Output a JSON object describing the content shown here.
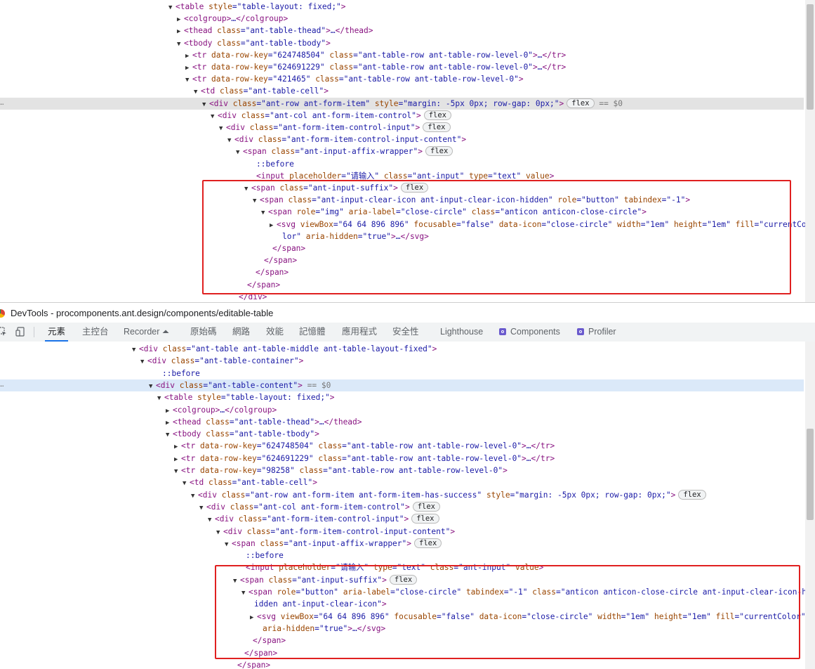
{
  "top_panel": {
    "lines": [
      {
        "indent": 250,
        "arrow": "open",
        "html": "<span class='t-tag'>&lt;table</span> <span class='t-attr'>style</span>=<span class='t-val'>\"table-layout: fixed;\"</span><span class='t-tag'>&gt;</span>"
      },
      {
        "indent": 262,
        "arrow": "closed",
        "html": "<span class='t-tag'>&lt;colgroup&gt;</span>…<span class='t-tag'>&lt;/colgroup&gt;</span>"
      },
      {
        "indent": 262,
        "arrow": "closed",
        "html": "<span class='t-tag'>&lt;thead</span> <span class='t-attr'>class</span>=<span class='t-val'>\"ant-table-thead\"</span><span class='t-tag'>&gt;</span>…<span class='t-tag'>&lt;/thead&gt;</span>"
      },
      {
        "indent": 262,
        "arrow": "open",
        "html": "<span class='t-tag'>&lt;tbody</span> <span class='t-attr'>class</span>=<span class='t-val'>\"ant-table-tbody\"</span><span class='t-tag'>&gt;</span>"
      },
      {
        "indent": 274,
        "arrow": "closed",
        "html": "<span class='t-tag'>&lt;tr</span> <span class='t-attr'>data-row-key</span>=<span class='t-val'>\"624748504\"</span> <span class='t-attr'>class</span>=<span class='t-val'>\"ant-table-row ant-table-row-level-0\"</span><span class='t-tag'>&gt;</span>…<span class='t-tag'>&lt;/tr&gt;</span>"
      },
      {
        "indent": 274,
        "arrow": "closed",
        "html": "<span class='t-tag'>&lt;tr</span> <span class='t-attr'>data-row-key</span>=<span class='t-val'>\"624691229\"</span> <span class='t-attr'>class</span>=<span class='t-val'>\"ant-table-row ant-table-row-level-0\"</span><span class='t-tag'>&gt;</span>…<span class='t-tag'>&lt;/tr&gt;</span>"
      },
      {
        "indent": 274,
        "arrow": "open",
        "html": "<span class='t-tag'>&lt;tr</span> <span class='t-attr'>data-row-key</span>=<span class='t-val'>\"421465\"</span> <span class='t-attr'>class</span>=<span class='t-val'>\"ant-table-row ant-table-row-level-0\"</span><span class='t-tag'>&gt;</span>"
      },
      {
        "indent": 286,
        "arrow": "open",
        "html": "<span class='t-tag'>&lt;td</span> <span class='t-attr'>class</span>=<span class='t-val'>\"ant-table-cell\"</span><span class='t-tag'>&gt;</span>"
      },
      {
        "indent": 298,
        "arrow": "open",
        "selected": "gray",
        "html": "<span class='t-tag'>&lt;div</span> <span class='t-attr'>class</span>=<span class='t-val'>\"ant-row ant-form-item\"</span> <span class='t-attr'>style</span>=<span class='t-val'>\"margin: -5px 0px; row-gap: 0px;\"</span><span class='t-tag'>&gt;</span><span class='badge'>flex</span> <span class='t-dim'>== $0</span>"
      },
      {
        "indent": 310,
        "arrow": "open",
        "html": "<span class='t-tag'>&lt;div</span> <span class='t-attr'>class</span>=<span class='t-val'>\"ant-col ant-form-item-control\"</span><span class='t-tag'>&gt;</span><span class='badge'>flex</span>"
      },
      {
        "indent": 322,
        "arrow": "open",
        "html": "<span class='t-tag'>&lt;div</span> <span class='t-attr'>class</span>=<span class='t-val'>\"ant-form-item-control-input\"</span><span class='t-tag'>&gt;</span><span class='badge'>flex</span>"
      },
      {
        "indent": 334,
        "arrow": "open",
        "html": "<span class='t-tag'>&lt;div</span> <span class='t-attr'>class</span>=<span class='t-val'>\"ant-form-item-control-input-content\"</span><span class='t-tag'>&gt;</span>"
      },
      {
        "indent": 346,
        "arrow": "open",
        "html": "<span class='t-tag'>&lt;span</span> <span class='t-attr'>class</span>=<span class='t-val'>\"ant-input-affix-wrapper\"</span><span class='t-tag'>&gt;</span><span class='badge'>flex</span>"
      },
      {
        "indent": 365,
        "arrow": "none",
        "html": "<span class='t-pseudo'>::before</span>"
      },
      {
        "indent": 365,
        "arrow": "none",
        "html": "<span class='t-tag'>&lt;input</span> <span class='t-attr'>placeholder</span>=<span class='t-val'>\"请输入\"</span> <span class='t-attr'>class</span>=<span class='t-val'>\"ant-input\"</span> <span class='t-attr'>type</span>=<span class='t-val'>\"text\"</span> <span class='t-attr'>value</span><span class='t-tag'>&gt;</span>"
      },
      {
        "indent": 358,
        "arrow": "open",
        "html": "<span class='t-tag'>&lt;span</span> <span class='t-attr'>class</span>=<span class='t-val'>\"ant-input-suffix\"</span><span class='t-tag'>&gt;</span><span class='badge'>flex</span>"
      },
      {
        "indent": 370,
        "arrow": "open",
        "html": "<span class='t-tag'>&lt;span</span> <span class='t-attr'>class</span>=<span class='t-val'>\"ant-input-clear-icon ant-input-clear-icon-hidden\"</span> <span class='t-attr'>role</span>=<span class='t-val'>\"button\"</span> <span class='t-attr'>tabindex</span>=<span class='t-val'>\"-1\"</span><span class='t-tag'>&gt;</span>"
      },
      {
        "indent": 382,
        "arrow": "open",
        "html": "<span class='t-tag'>&lt;span</span> <span class='t-attr'>role</span>=<span class='t-val'>\"img\"</span> <span class='t-attr'>aria-label</span>=<span class='t-val'>\"close-circle\"</span> <span class='t-attr'>class</span>=<span class='t-val'>\"anticon anticon-close-circle\"</span><span class='t-tag'>&gt;</span>"
      },
      {
        "indent": 394,
        "arrow": "closed",
        "html": "<span class='t-tag'>&lt;svg</span> <span class='t-attr'>viewBox</span>=<span class='t-val'>\"64 64 896 896\"</span> <span class='t-attr'>focusable</span>=<span class='t-val'>\"false\"</span> <span class='t-attr'>data-icon</span>=<span class='t-val'>\"close-circle\"</span> <span class='t-attr'>width</span>=<span class='t-val'>\"1em\"</span> <span class='t-attr'>height</span>=<span class='t-val'>\"1em\"</span> <span class='t-attr'>fill</span>=<span class='t-val'>\"currentCo</span>"
      },
      {
        "indent": 402,
        "arrow": "none",
        "html": "<span class='t-val'>lor\"</span> <span class='t-attr'>aria-hidden</span>=<span class='t-val'>\"true\"</span><span class='t-tag'>&gt;</span>…<span class='t-tag'>&lt;/svg&gt;</span>"
      },
      {
        "indent": 388,
        "arrow": "none",
        "html": "<span class='t-tag'>&lt;/span&gt;</span>"
      },
      {
        "indent": 376,
        "arrow": "none",
        "html": "<span class='t-tag'>&lt;/span&gt;</span>"
      },
      {
        "indent": 364,
        "arrow": "none",
        "html": "<span class='t-tag'>&lt;/span&gt;</span>"
      },
      {
        "indent": 352,
        "arrow": "none",
        "html": "<span class='t-tag'>&lt;/span&gt;</span>"
      },
      {
        "indent": 340,
        "arrow": "none",
        "html": "<span class='t-tag'>&lt;/div&gt;</span>"
      }
    ]
  },
  "titlebar": {
    "title": "DevTools - procomponents.ant.design/components/editable-table"
  },
  "tabs": [
    {
      "label": "元素",
      "active": true
    },
    {
      "label": "主控台"
    },
    {
      "label": "Recorder ⏶"
    },
    {
      "label": "原始碼"
    },
    {
      "label": "網路"
    },
    {
      "label": "效能"
    },
    {
      "label": "記憶體"
    },
    {
      "label": "應用程式"
    },
    {
      "label": "安全性"
    },
    {
      "label": "Lighthouse"
    },
    {
      "label": "Components",
      "icon": "react-extension-icon"
    },
    {
      "label": "Profiler",
      "icon": "react-extension-icon"
    }
  ],
  "bottom_panel": {
    "lines": [
      {
        "indent": 198,
        "arrow": "open",
        "html": "<span class='t-tag'>&lt;div</span> <span class='t-attr'>class</span>=<span class='t-val'>\"ant-table ant-table-middle ant-table-layout-fixed\"</span><span class='t-tag'>&gt;</span>"
      },
      {
        "indent": 210,
        "arrow": "open",
        "html": "<span class='t-tag'>&lt;div</span> <span class='t-attr'>class</span>=<span class='t-val'>\"ant-table-container\"</span><span class='t-tag'>&gt;</span>"
      },
      {
        "indent": 231,
        "arrow": "none",
        "html": "<span class='t-pseudo'>::before</span>"
      },
      {
        "indent": 222,
        "arrow": "open",
        "selected": "blue",
        "html": "<span class='t-tag'>&lt;div</span> <span class='t-attr'>class</span>=<span class='t-val'>\"ant-table-content\"</span><span class='t-tag'>&gt;</span> <span class='t-dim'>== $0</span>"
      },
      {
        "indent": 234,
        "arrow": "open",
        "html": "<span class='t-tag'>&lt;table</span> <span class='t-attr'>style</span>=<span class='t-val'>\"table-layout: fixed;\"</span><span class='t-tag'>&gt;</span>"
      },
      {
        "indent": 246,
        "arrow": "closed",
        "html": "<span class='t-tag'>&lt;colgroup&gt;</span>…<span class='t-tag'>&lt;/colgroup&gt;</span>"
      },
      {
        "indent": 246,
        "arrow": "closed",
        "html": "<span class='t-tag'>&lt;thead</span> <span class='t-attr'>class</span>=<span class='t-val'>\"ant-table-thead\"</span><span class='t-tag'>&gt;</span>…<span class='t-tag'>&lt;/thead&gt;</span>"
      },
      {
        "indent": 246,
        "arrow": "open",
        "html": "<span class='t-tag'>&lt;tbody</span> <span class='t-attr'>class</span>=<span class='t-val'>\"ant-table-tbody\"</span><span class='t-tag'>&gt;</span>"
      },
      {
        "indent": 258,
        "arrow": "closed",
        "html": "<span class='t-tag'>&lt;tr</span> <span class='t-attr'>data-row-key</span>=<span class='t-val'>\"624748504\"</span> <span class='t-attr'>class</span>=<span class='t-val'>\"ant-table-row ant-table-row-level-0\"</span><span class='t-tag'>&gt;</span>…<span class='t-tag'>&lt;/tr&gt;</span>"
      },
      {
        "indent": 258,
        "arrow": "closed",
        "html": "<span class='t-tag'>&lt;tr</span> <span class='t-attr'>data-row-key</span>=<span class='t-val'>\"624691229\"</span> <span class='t-attr'>class</span>=<span class='t-val'>\"ant-table-row ant-table-row-level-0\"</span><span class='t-tag'>&gt;</span>…<span class='t-tag'>&lt;/tr&gt;</span>"
      },
      {
        "indent": 258,
        "arrow": "open",
        "html": "<span class='t-tag'>&lt;tr</span> <span class='t-attr'>data-row-key</span>=<span class='t-val'>\"98258\"</span> <span class='t-attr'>class</span>=<span class='t-val'>\"ant-table-row ant-table-row-level-0\"</span><span class='t-tag'>&gt;</span>"
      },
      {
        "indent": 270,
        "arrow": "open",
        "html": "<span class='t-tag'>&lt;td</span> <span class='t-attr'>class</span>=<span class='t-val'>\"ant-table-cell\"</span><span class='t-tag'>&gt;</span>"
      },
      {
        "indent": 282,
        "arrow": "open",
        "html": "<span class='t-tag'>&lt;div</span> <span class='t-attr'>class</span>=<span class='t-val'>\"ant-row ant-form-item ant-form-item-has-success\"</span> <span class='t-attr'>style</span>=<span class='t-val'>\"margin: -5px 0px; row-gap: 0px;\"</span><span class='t-tag'>&gt;</span><span class='badge'>flex</span>"
      },
      {
        "indent": 294,
        "arrow": "open",
        "html": "<span class='t-tag'>&lt;div</span> <span class='t-attr'>class</span>=<span class='t-val'>\"ant-col ant-form-item-control\"</span><span class='t-tag'>&gt;</span><span class='badge'>flex</span>"
      },
      {
        "indent": 306,
        "arrow": "open",
        "html": "<span class='t-tag'>&lt;div</span> <span class='t-attr'>class</span>=<span class='t-val'>\"ant-form-item-control-input\"</span><span class='t-tag'>&gt;</span><span class='badge'>flex</span>"
      },
      {
        "indent": 318,
        "arrow": "open",
        "html": "<span class='t-tag'>&lt;div</span> <span class='t-attr'>class</span>=<span class='t-val'>\"ant-form-item-control-input-content\"</span><span class='t-tag'>&gt;</span>"
      },
      {
        "indent": 330,
        "arrow": "open",
        "html": "<span class='t-tag'>&lt;span</span> <span class='t-attr'>class</span>=<span class='t-val'>\"ant-input-affix-wrapper\"</span><span class='t-tag'>&gt;</span><span class='badge'>flex</span>"
      },
      {
        "indent": 350,
        "arrow": "none",
        "html": "<span class='t-pseudo'>::before</span>"
      },
      {
        "indent": 350,
        "arrow": "none",
        "html": "<span class='t-tag'>&lt;input</span> <span class='t-attr'>placeholder</span>=<span class='t-val'>\"请输入\"</span> <span class='t-attr'>type</span>=<span class='t-val'>\"text\"</span> <span class='t-attr'>class</span>=<span class='t-val'>\"ant-input\"</span> <span class='t-attr'>value</span><span class='t-tag'>&gt;</span>"
      },
      {
        "indent": 342,
        "arrow": "open",
        "html": "<span class='t-tag'>&lt;span</span> <span class='t-attr'>class</span>=<span class='t-val'>\"ant-input-suffix\"</span><span class='t-tag'>&gt;</span><span class='badge'>flex</span>"
      },
      {
        "indent": 354,
        "arrow": "open",
        "html": "<span class='t-tag'>&lt;span</span> <span class='t-attr'>role</span>=<span class='t-val'>\"button\"</span> <span class='t-attr'>aria-label</span>=<span class='t-val'>\"close-circle\"</span> <span class='t-attr'>tabindex</span>=<span class='t-val'>\"-1\"</span> <span class='t-attr'>class</span>=<span class='t-val'>\"anticon anticon-close-circle ant-input-clear-icon-h</span>"
      },
      {
        "indent": 362,
        "arrow": "none",
        "html": "<span class='t-val'>idden ant-input-clear-icon\"</span><span class='t-tag'>&gt;</span>"
      },
      {
        "indent": 366,
        "arrow": "closed",
        "html": "<span class='t-tag'>&lt;svg</span> <span class='t-attr'>viewBox</span>=<span class='t-val'>\"64 64 896 896\"</span> <span class='t-attr'>focusable</span>=<span class='t-val'>\"false\"</span> <span class='t-attr'>data-icon</span>=<span class='t-val'>\"close-circle\"</span> <span class='t-attr'>width</span>=<span class='t-val'>\"1em\"</span> <span class='t-attr'>height</span>=<span class='t-val'>\"1em\"</span> <span class='t-attr'>fill</span>=<span class='t-val'>\"currentColor\"</span>"
      },
      {
        "indent": 374,
        "arrow": "none",
        "html": "<span class='t-attr'>aria-hidden</span>=<span class='t-val'>\"true\"</span><span class='t-tag'>&gt;</span>…<span class='t-tag'>&lt;/svg&gt;</span>"
      },
      {
        "indent": 360,
        "arrow": "none",
        "html": "<span class='t-tag'>&lt;/span&gt;</span>"
      },
      {
        "indent": 348,
        "arrow": "none",
        "html": "<span class='t-tag'>&lt;/span&gt;</span>"
      },
      {
        "indent": 338,
        "arrow": "none",
        "html": "<span class='t-tag'>&lt;/span&gt;</span>"
      }
    ]
  },
  "colors": {
    "highlight_box": "#e02020",
    "tag": "#881280",
    "attr": "#994500",
    "value": "#1a1aa6",
    "active_tab_underline": "#1a73e8"
  }
}
